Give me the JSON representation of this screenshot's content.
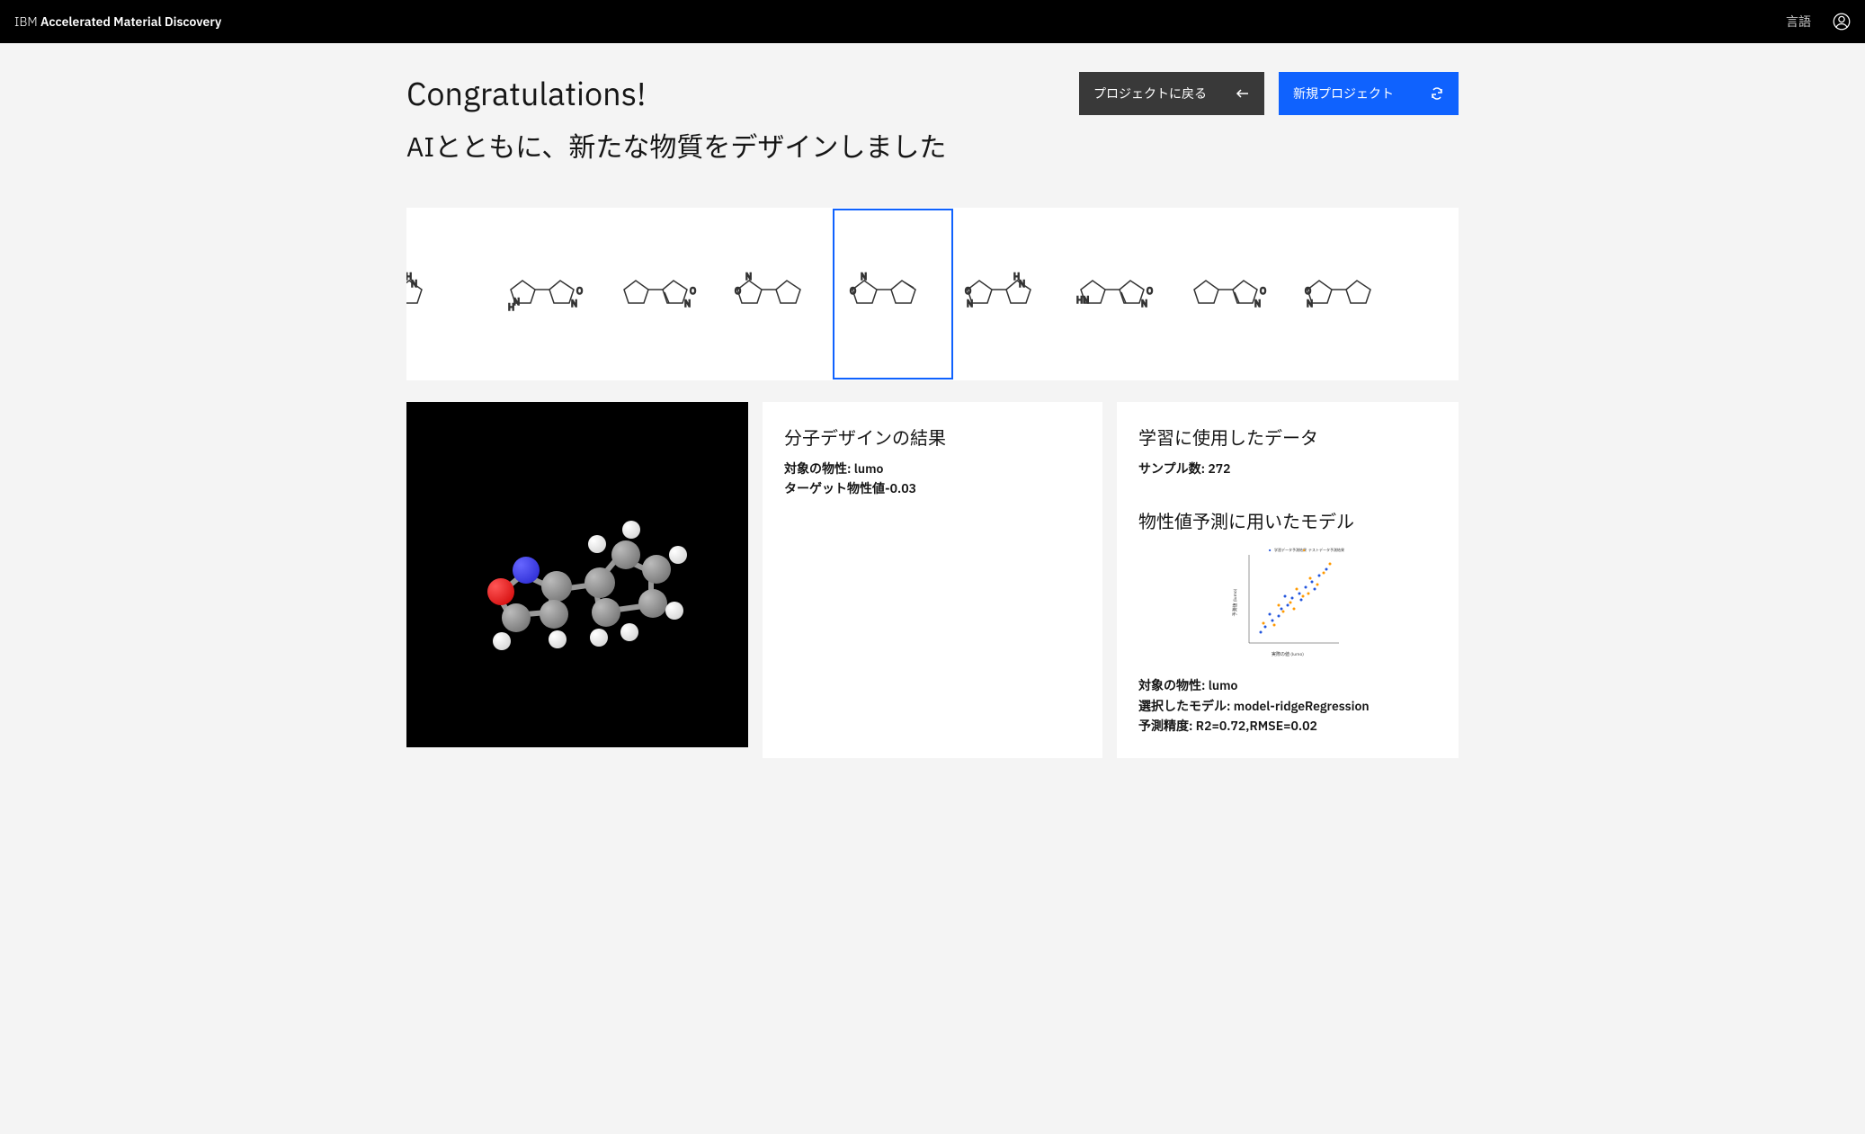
{
  "header": {
    "brand_prefix": "IBM",
    "brand_name": "Accelerated Material Discovery",
    "language_label": "言語"
  },
  "title": {
    "congrats": "Congratulations!",
    "subtitle": "AIとともに、新たな物質をデザインしました"
  },
  "buttons": {
    "back_to_project": "プロジェクトに戻る",
    "new_project": "新規プロジェクト"
  },
  "result_panel": {
    "heading": "分子デザインの結果",
    "property_label": "対象の物性: ",
    "property_value": "lumo",
    "target_label": "ターゲット物性値",
    "target_value": "-0.03"
  },
  "data_panel": {
    "heading": "学習に使用したデータ",
    "samples_label": "サンプル数: ",
    "samples_value": "272",
    "model_heading": "物性値予測に用いたモデル",
    "property_label": "対象の物性: ",
    "property_value": "lumo",
    "model_label": "選択したモデル: ",
    "model_value": "model-ridgeRegression",
    "accuracy_label": "予測精度: ",
    "accuracy_value": "R2=0.72,RMSE=0.02",
    "chart_legend_train": "学習データ予測結果",
    "chart_legend_test": "テストデータ予測結果",
    "chart_xlabel": "実際の値 (lumo)",
    "chart_ylabel": "予測値 (lumo)"
  },
  "molecules": [
    {
      "id": 0,
      "selected": false
    },
    {
      "id": 1,
      "selected": false
    },
    {
      "id": 2,
      "selected": false
    },
    {
      "id": 3,
      "selected": false
    },
    {
      "id": 4,
      "selected": true
    },
    {
      "id": 5,
      "selected": false
    },
    {
      "id": 6,
      "selected": false
    },
    {
      "id": 7,
      "selected": false
    },
    {
      "id": 8,
      "selected": false
    }
  ]
}
